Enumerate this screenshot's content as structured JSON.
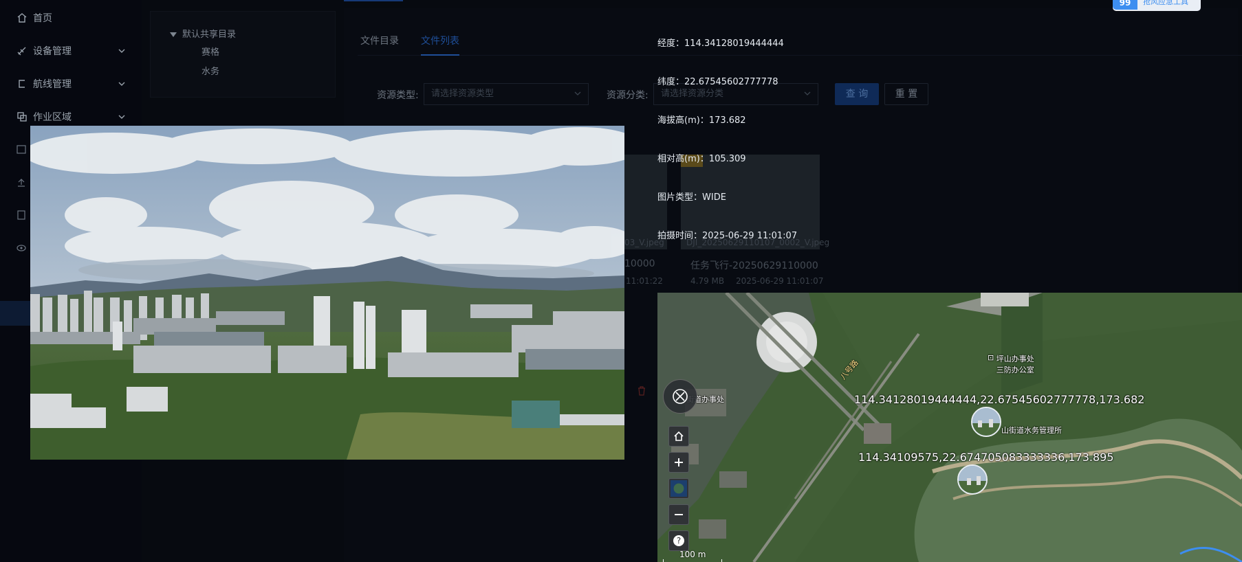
{
  "sidebar": {
    "items": [
      {
        "label": "首页",
        "icon": "home-icon"
      },
      {
        "label": "设备管理",
        "icon": "device-icon"
      },
      {
        "label": "航线管理",
        "icon": "route-icon"
      },
      {
        "label": "作业区域",
        "icon": "area-icon"
      }
    ]
  },
  "tree": {
    "root": "默认共享目录",
    "children": [
      "赛格",
      "水务"
    ]
  },
  "tabs": [
    "文件目录",
    "文件列表"
  ],
  "active_tab": "文件列表",
  "filters": {
    "type_label": "资源类型:",
    "type_placeholder": "请选择资源类型",
    "category_label": "资源分类:",
    "category_placeholder": "请选择资源分类",
    "query_button": "查 询",
    "reset_button": "重 置"
  },
  "badge": {
    "count": "99",
    "text": "抢风应急工具"
  },
  "background_cards": [
    {
      "filename": "03_V.jpeg",
      "task": "10000",
      "time": "11:01:22"
    },
    {
      "filename": "DJI_20250629110107_0002_V.jpeg",
      "task": "任务飞行-20250629110000",
      "size": "4.79 MB",
      "time": "2025-06-29 11:01:07"
    }
  ],
  "metadata": [
    {
      "key": "经度：",
      "value": "114.34128019444444"
    },
    {
      "key": "纬度：",
      "value": "22.67545602777778"
    },
    {
      "key": "海拔高(m)：",
      "value": "173.682"
    },
    {
      "key": "相对高(m)：",
      "value": "105.309"
    },
    {
      "key": "图片类型：",
      "value": "WIDE"
    },
    {
      "key": "拍摄时间：",
      "value": "2025-06-29 11:01:07"
    }
  ],
  "map": {
    "markers": [
      {
        "label": "114.34128019444444,22.67545602777778,173.682"
      },
      {
        "label": "114.34109575,22.674705083333336,173.895"
      }
    ],
    "pois": [
      "坪山办事处三防办公室",
      "山街道水务管理所",
      "街道办事处"
    ],
    "road_label": "八号路",
    "scale_label": "100 m",
    "controls": [
      "home-icon",
      "zoom-in-icon",
      "layers-icon",
      "zoom-out-icon",
      "help-icon"
    ]
  }
}
